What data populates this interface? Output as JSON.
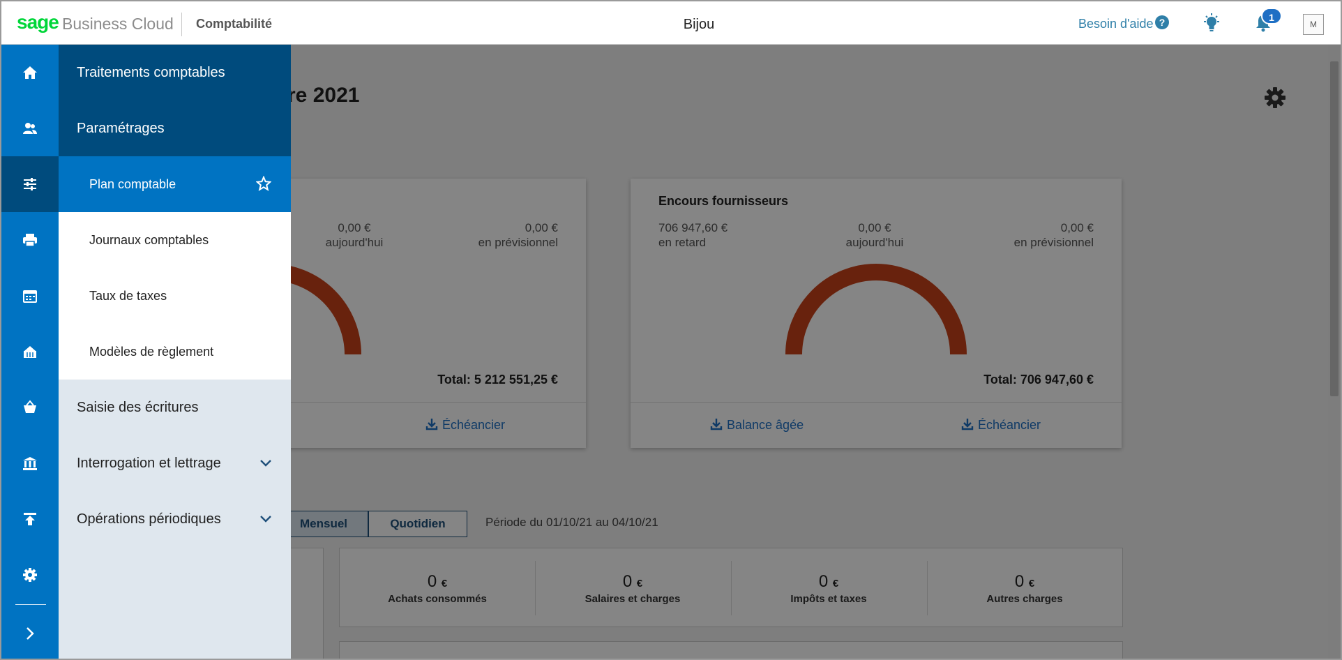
{
  "topbar": {
    "logo": "sage",
    "brand": "Business Cloud",
    "product": "Comptabilité",
    "company": "Bijou",
    "help_label": "Besoin d'aide",
    "help_icon": "?",
    "notifications": "1",
    "avatar": "M"
  },
  "page": {
    "title": "re 2021"
  },
  "card_clients": {
    "today_value": "0,00 €",
    "today_label": "aujourd'hui",
    "forecast_value": "0,00 €",
    "forecast_label": "en prévisionnel",
    "total": "Total: 5 212 551,25 €",
    "link_schedule": "Échéancier"
  },
  "card_suppliers": {
    "title": "Encours fournisseurs",
    "late_value": "706 947,60 €",
    "late_label": "en retard",
    "today_value": "0,00 €",
    "today_label": "aujourd'hui",
    "forecast_value": "0,00 €",
    "forecast_label": "en prévisionnel",
    "total": "Total: 706 947,60 €",
    "link_aged": "Balance âgée",
    "link_schedule": "Échéancier"
  },
  "period": {
    "monthly": "Mensuel",
    "daily": "Quotidien",
    "range": "Période du 01/10/21 au 04/10/21"
  },
  "kpis": [
    {
      "value": "0",
      "unit": "€",
      "label": "Achats consommés"
    },
    {
      "value": "0",
      "unit": "€",
      "label": "Salaires et charges"
    },
    {
      "value": "0",
      "unit": "€",
      "label": "Impôts et taxes"
    },
    {
      "value": "0",
      "unit": "€",
      "label": "Autres charges"
    }
  ],
  "menu": {
    "treatments": "Traitements comptables",
    "settings": "Paramétrages",
    "chart_of_accounts": "Plan comptable",
    "journals": "Journaux comptables",
    "tax_rates": "Taux de taxes",
    "payment_models": "Modèles de règlement",
    "entries": "Saisie des écritures",
    "query_matching": "Interrogation et lettrage",
    "periodic_ops": "Opérations périodiques"
  },
  "colors": {
    "sidebar": "#0073c2",
    "sidebar_dark": "#004b7d",
    "menu_light": "#dfe7ee",
    "gauge": "#c8421a",
    "link": "#1e6fc4",
    "brand_green": "#00d639"
  }
}
